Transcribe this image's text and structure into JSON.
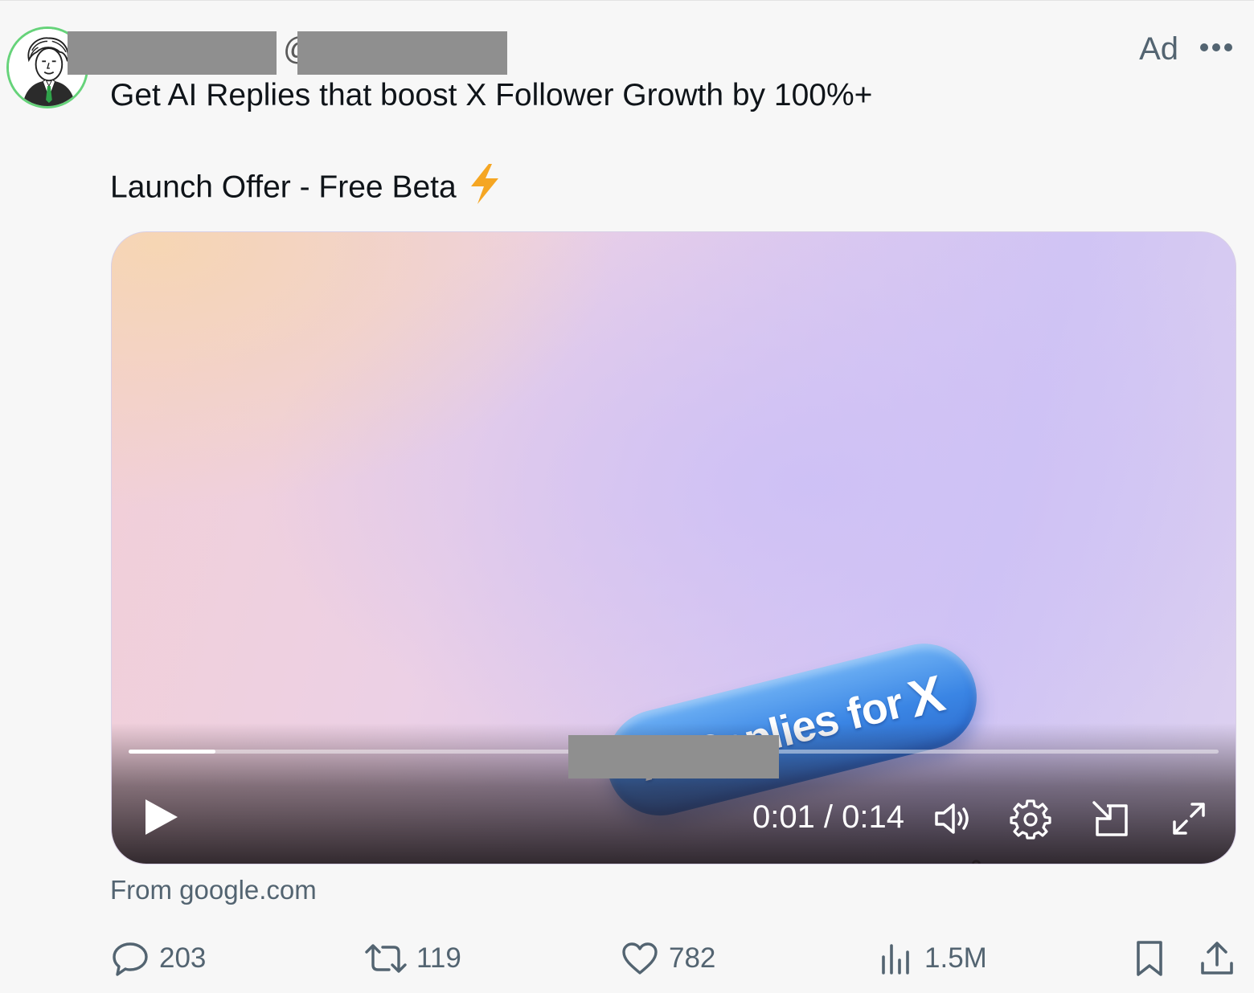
{
  "post": {
    "ad_label": "Ad",
    "at_symbol": "@",
    "line1": "Get AI Replies that boost X Follower Growth by 100%+",
    "line2": "Launch Offer - Free Beta",
    "line2_emoji_icon": "lightning-bolt-icon",
    "source": "From google.com"
  },
  "video": {
    "pill_text": "AI Replies for",
    "pill_x": "X",
    "current_time": "0:01",
    "duration": "0:14",
    "time_display": "0:01 / 0:14",
    "progress": 0.08,
    "icons": [
      "play-icon",
      "volume-icon",
      "settings-gear-icon",
      "picture-in-picture-icon",
      "fullscreen-icon"
    ]
  },
  "actions": {
    "replies": "203",
    "reposts": "119",
    "likes": "782",
    "views": "1.5M"
  },
  "colors": {
    "avatar_ring": "#66d37a",
    "pill_blue": "#3a85e4",
    "muted_text": "#536471",
    "bolt": "#f5a623",
    "redaction": "#8f8f8f"
  }
}
